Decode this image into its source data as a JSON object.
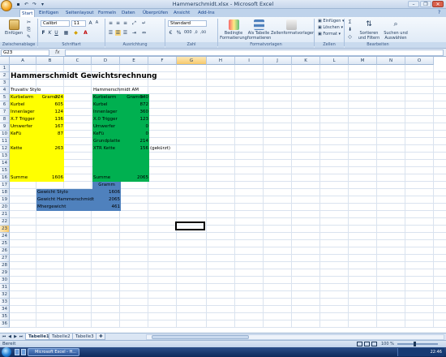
{
  "window": {
    "title": "Hammerschmidt.xlsx - Microsoft Excel"
  },
  "ribbon": {
    "tabs": [
      "Start",
      "Einfügen",
      "Seitenlayout",
      "Formeln",
      "Daten",
      "Überprüfen",
      "Ansicht",
      "Add-Ins"
    ],
    "active_tab": "Start",
    "clipboard": {
      "paste_label": "Einfügen",
      "group": "Zwischenablage"
    },
    "font": {
      "name": "Calibri",
      "size": "11",
      "group": "Schriftart"
    },
    "alignment": {
      "group": "Ausrichtung"
    },
    "number": {
      "format": "Standard",
      "group": "Zahl"
    },
    "styles": {
      "conditional": "Bedingte Formatierung",
      "as_table": "Als Tabelle formatieren",
      "cell_styles": "Zellenformatvorlagen",
      "group": "Formatvorlagen"
    },
    "cells": {
      "insert": "Einfügen",
      "delete": "Löschen",
      "format": "Format",
      "group": "Zellen"
    },
    "editing": {
      "sort": "Sortieren und Filtern",
      "find": "Suchen und Auswählen",
      "group": "Bearbeiten"
    }
  },
  "formula_bar": {
    "name_box": "G23",
    "fx": "fx",
    "formula": ""
  },
  "columns": [
    "A",
    "B",
    "C",
    "D",
    "E",
    "F",
    "G",
    "H",
    "I",
    "J",
    "K",
    "L",
    "M",
    "N",
    "O"
  ],
  "rows": [
    "1",
    "2",
    "3",
    "4",
    "5",
    "6",
    "7",
    "8",
    "9",
    "10",
    "11",
    "12",
    "13",
    "14",
    "15",
    "16",
    "17",
    "18",
    "19",
    "20",
    "21",
    "22",
    "23",
    "24",
    "25",
    "26",
    "27",
    "28",
    "29",
    "30",
    "31",
    "32",
    "33",
    "34",
    "35",
    "36"
  ],
  "selected": {
    "column": "G",
    "row": "23"
  },
  "colors": {
    "yellow": "#ffff00",
    "green": "#00b050",
    "blue": "#4f81bd"
  },
  "sheet": {
    "title": "Hammerschmidt Gewichtsrechnung",
    "stylo": {
      "header": "Truvativ Stylo",
      "unit": "Gramm",
      "items": [
        {
          "name": "Kurbelarm",
          "value": "224"
        },
        {
          "name": "Kurbel",
          "value": "605"
        },
        {
          "name": "Innenlager",
          "value": "124"
        },
        {
          "name": "X.7 Trigger",
          "value": "136"
        },
        {
          "name": "Umwerfer",
          "value": "167"
        },
        {
          "name": "KeFü",
          "value": "87"
        },
        {
          "name": "",
          "value": ""
        },
        {
          "name": "Kette",
          "value": "263"
        }
      ],
      "sum_label": "Summe",
      "sum_value": "1606"
    },
    "hammerschmidt": {
      "header": "Hammerschmidt AM",
      "unit": "Gramm",
      "items": [
        {
          "name": "Kurbelarm",
          "value": "340"
        },
        {
          "name": "Kurbel",
          "value": "872"
        },
        {
          "name": "Innenlager",
          "value": "360"
        },
        {
          "name": "X.0 Trigger",
          "value": "123"
        },
        {
          "name": "Umwerfer",
          "value": "0"
        },
        {
          "name": "KeFü",
          "value": "0"
        },
        {
          "name": "Grundplatte",
          "value": "214"
        },
        {
          "name": "XTR Kette",
          "value": "156",
          "note": "(gekürzt)"
        }
      ],
      "sum_label": "Summe",
      "sum_value": "2065"
    },
    "summary": {
      "unit": "Gramm",
      "rows": [
        {
          "label": "Gewicht Stylo",
          "value": "1606"
        },
        {
          "label": "Gewicht Hammerschmidt",
          "value": "2065"
        },
        {
          "label": "Mhergewicht",
          "value": "461"
        }
      ]
    }
  },
  "sheet_tabs": [
    "Tabelle1",
    "Tabelle2",
    "Tabelle3"
  ],
  "active_sheet": "Tabelle1",
  "status": {
    "text": "Bereit",
    "zoom": "100 %"
  },
  "taskbar": {
    "button": "Microsoft Excel - H...",
    "clock": "22:46"
  }
}
